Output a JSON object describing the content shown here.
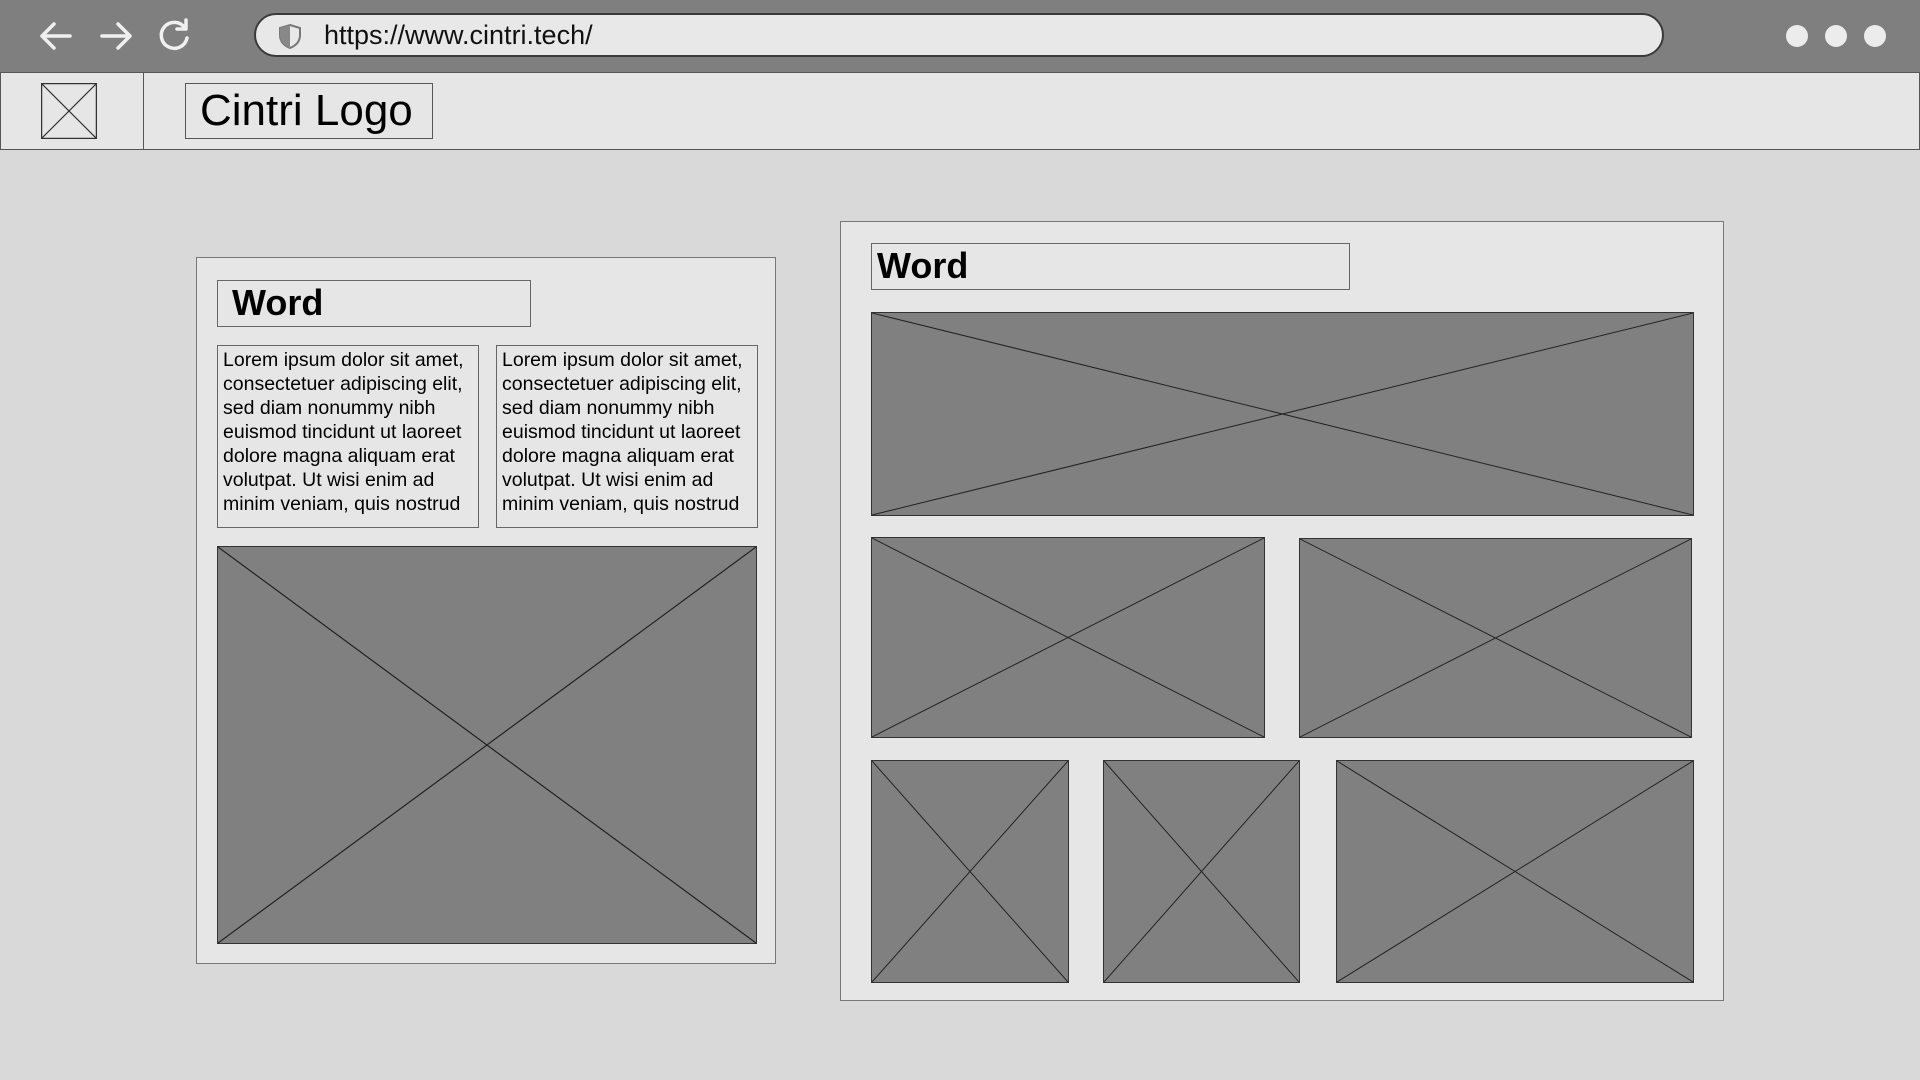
{
  "browser": {
    "url": "https://www.cintri.tech/",
    "back_icon": "back-arrow-icon",
    "forward_icon": "forward-arrow-icon",
    "reload_icon": "reload-icon",
    "security_icon": "shield-icon",
    "menu_icon": "more-dots-icon"
  },
  "header": {
    "logo_text": "Cintri Logo"
  },
  "left_panel": {
    "heading": "Word",
    "text_1": "Lorem ipsum dolor sit amet, consectetuer adipiscing elit, sed diam nonummy nibh euismod tincidunt ut laoreet dolore magna aliquam erat volutpat. Ut wisi enim ad minim veniam, quis nostrud",
    "text_2": "Lorem ipsum dolor sit amet, consectetuer adipiscing elit, sed diam nonummy nibh euismod tincidunt ut laoreet dolore magna aliquam erat volutpat. Ut wisi enim ad minim veniam, quis nostrud"
  },
  "right_panel": {
    "heading": "Word"
  },
  "colors": {
    "chrome": "#7f7f7f",
    "page_background": "#d9d9d9",
    "panel": "#e6e6e6",
    "placeholder": "#808080"
  }
}
